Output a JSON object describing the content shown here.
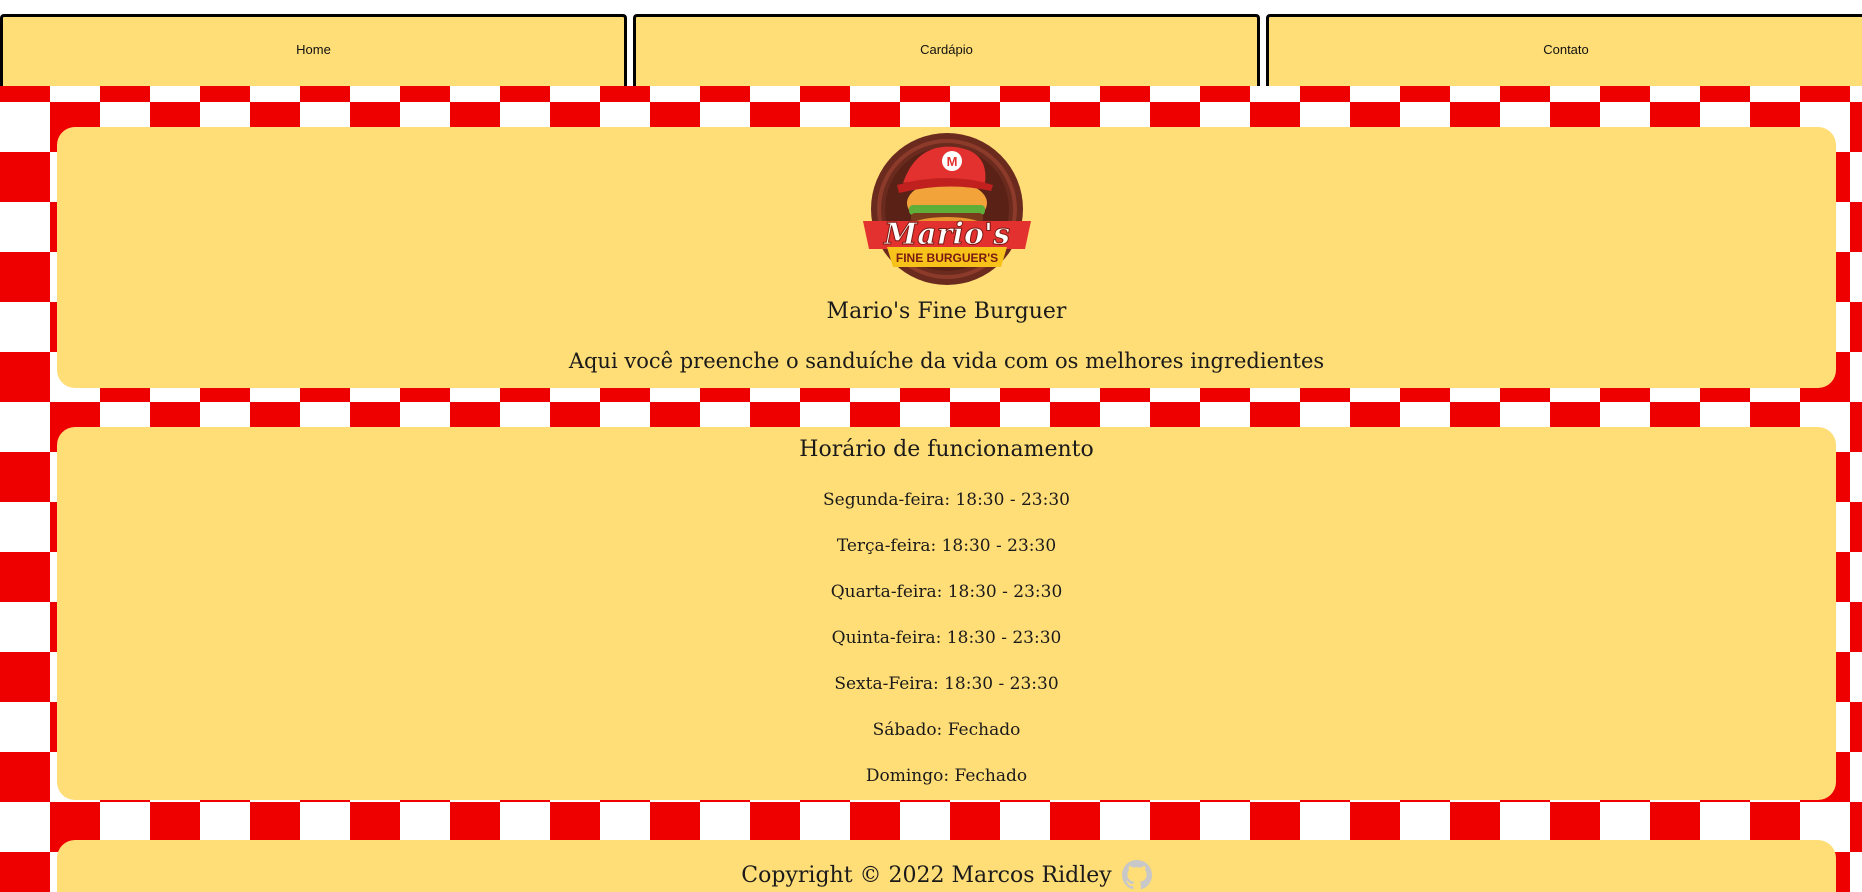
{
  "nav": {
    "items": [
      {
        "label": "Home"
      },
      {
        "label": "Cardápio"
      },
      {
        "label": "Contato"
      }
    ]
  },
  "hero": {
    "logo": {
      "icon": "marios-logo-icon",
      "text_main": "Mario's",
      "text_banner": "FINE BURGUER'S",
      "cap_letter": "M"
    },
    "title": "Mario's Fine Burguer",
    "tagline": "Aqui você preenche o sanduíche da vida com os melhores ingredientes"
  },
  "hours": {
    "title": "Horário de funcionamento",
    "days": [
      {
        "text": "Segunda-feira: 18:30 - 23:30"
      },
      {
        "text": "Terça-feira: 18:30 - 23:30"
      },
      {
        "text": "Quarta-feira: 18:30 - 23:30"
      },
      {
        "text": "Quinta-feira: 18:30 - 23:30"
      },
      {
        "text": "Sexta-Feira: 18:30 - 23:30"
      },
      {
        "text": "Sábado: Fechado"
      },
      {
        "text": "Domingo: Fechado"
      }
    ]
  },
  "footer": {
    "copyright": "Copyright © 2022 Marcos Ridley",
    "icon": "github-icon"
  },
  "colors": {
    "card": "#ffdd77",
    "checker_red": "#ee0000",
    "checker_white": "#ffffff"
  }
}
